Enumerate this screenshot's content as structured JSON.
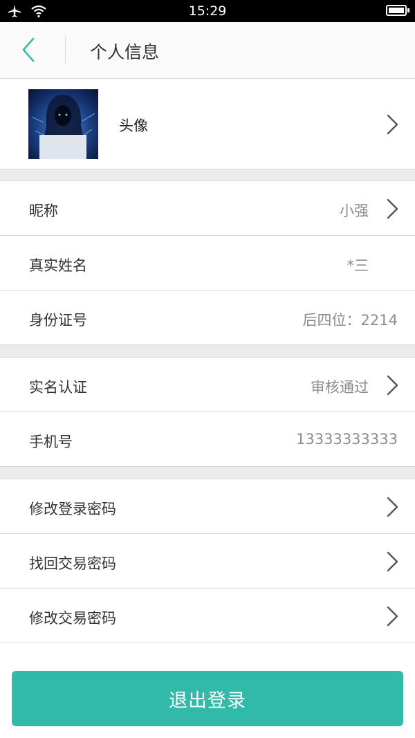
{
  "status_bar": {
    "time": "15:29",
    "icons": [
      "airplane-icon",
      "wifi-icon",
      "battery-icon"
    ]
  },
  "header": {
    "title": "个人信息",
    "back_icon": "chevron-left-icon"
  },
  "profile": {
    "avatar_label": "头像"
  },
  "info_rows": [
    {
      "label": "昵称",
      "value": "小强"
    },
    {
      "label": "真实姓名",
      "value": "*三"
    },
    {
      "label": "身份证号",
      "value": "后四位：2214"
    }
  ],
  "verify_rows": [
    {
      "label": "实名认证",
      "value": "审核通过"
    },
    {
      "label": "手机号",
      "value": "13333333333"
    }
  ],
  "security_rows": [
    {
      "label": "修改登录密码"
    },
    {
      "label": "找回交易密码"
    },
    {
      "label": "修改交易密码"
    }
  ],
  "logout_label": "退出登录",
  "colors": {
    "accent": "#31b9a9",
    "back_icon": "#31b9a9",
    "label_text": "#333333",
    "value_text": "#8c8c8c",
    "divider": "#d9d9d9",
    "section_gap": "#ececec"
  }
}
